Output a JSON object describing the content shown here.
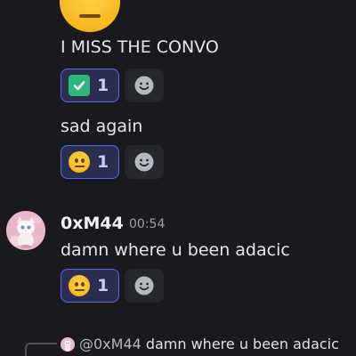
{
  "messages": {
    "first": {
      "text": "I MISS THE CONVO",
      "reaction": {
        "emoji": "check-mark",
        "count": "1"
      }
    },
    "second": {
      "text": "sad again",
      "reaction": {
        "emoji": "neutral-face",
        "count": "1"
      }
    },
    "third": {
      "author": "0xM44",
      "time": "00:54",
      "text": "damn where u been adacic",
      "reaction": {
        "emoji": "neutral-face",
        "count": "1"
      }
    }
  },
  "reply": {
    "mention": "@0xM44",
    "text": "damn where u been adacic"
  },
  "colors": {
    "background": "#1a1a1e",
    "reaction_active_border": "#5865f2",
    "reaction_active_bg": "#2a2e50",
    "check_green": "#2eb67d"
  }
}
